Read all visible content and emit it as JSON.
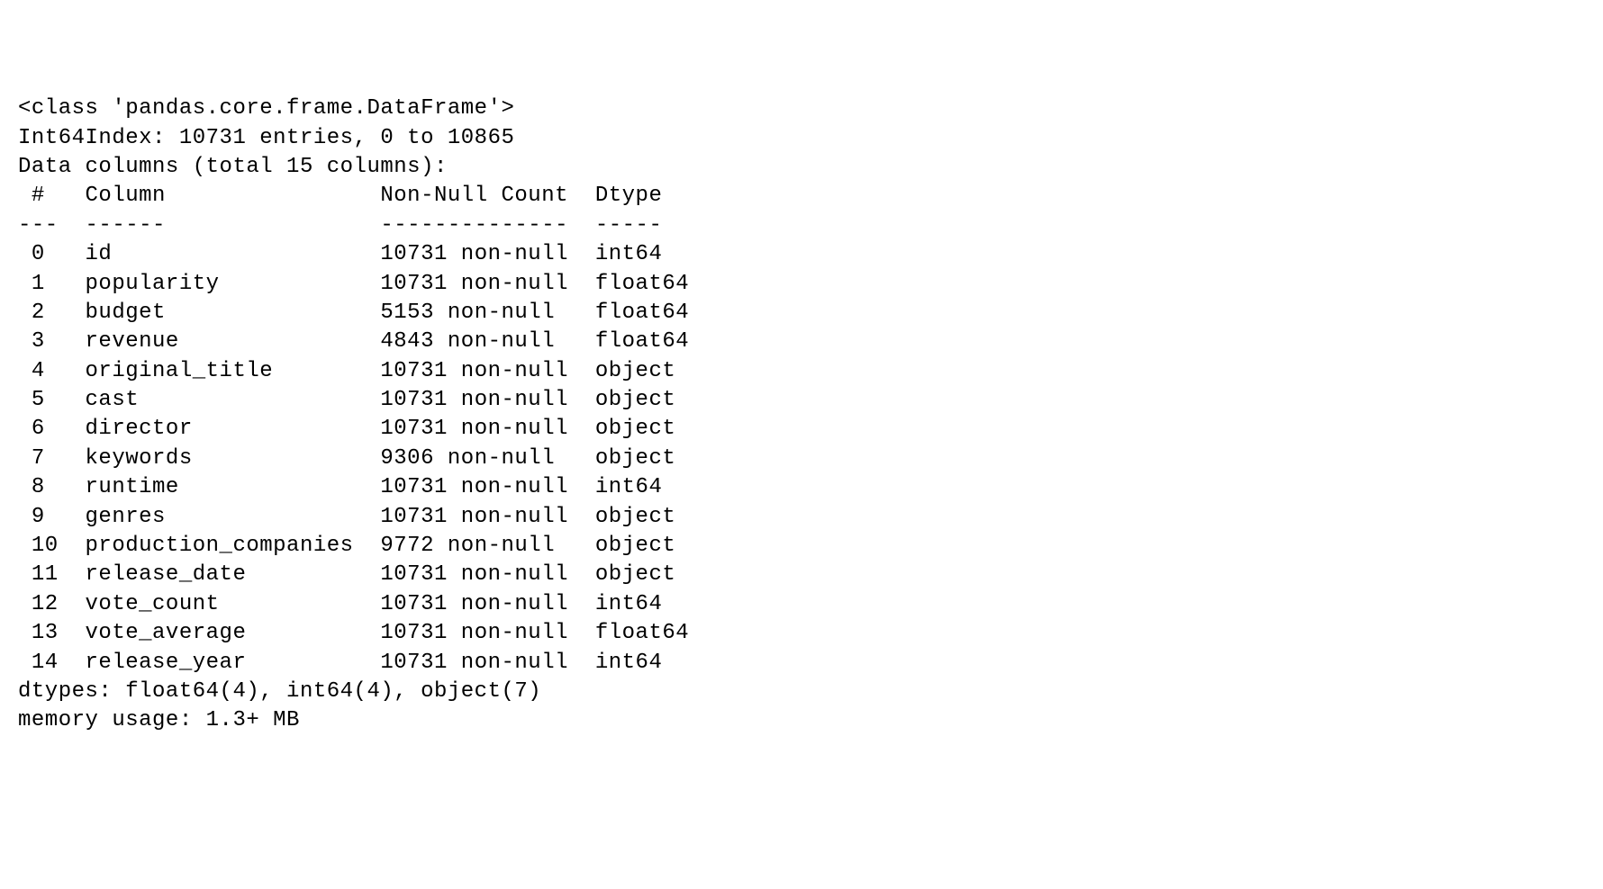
{
  "class_line": "<class 'pandas.core.frame.DataFrame'>",
  "index_line": "Int64Index: 10731 entries, 0 to 10865",
  "columns_line": "Data columns (total 15 columns):",
  "header": {
    "idx": " #  ",
    "column": "Column              ",
    "nonnull": "Non-Null Count",
    "dtype": "Dtype  "
  },
  "divider": {
    "idx": "--- ",
    "column": "------              ",
    "nonnull": "--------------",
    "dtype": "-----  "
  },
  "rows": [
    {
      "idx": " 0  ",
      "column": "id                  ",
      "nonnull": "10731 non-null",
      "dtype": "int64  "
    },
    {
      "idx": " 1  ",
      "column": "popularity          ",
      "nonnull": "10731 non-null",
      "dtype": "float64"
    },
    {
      "idx": " 2  ",
      "column": "budget              ",
      "nonnull": "5153 non-null ",
      "dtype": "float64"
    },
    {
      "idx": " 3  ",
      "column": "revenue             ",
      "nonnull": "4843 non-null ",
      "dtype": "float64"
    },
    {
      "idx": " 4  ",
      "column": "original_title      ",
      "nonnull": "10731 non-null",
      "dtype": "object "
    },
    {
      "idx": " 5  ",
      "column": "cast                ",
      "nonnull": "10731 non-null",
      "dtype": "object "
    },
    {
      "idx": " 6  ",
      "column": "director            ",
      "nonnull": "10731 non-null",
      "dtype": "object "
    },
    {
      "idx": " 7  ",
      "column": "keywords            ",
      "nonnull": "9306 non-null ",
      "dtype": "object "
    },
    {
      "idx": " 8  ",
      "column": "runtime             ",
      "nonnull": "10731 non-null",
      "dtype": "int64  "
    },
    {
      "idx": " 9  ",
      "column": "genres              ",
      "nonnull": "10731 non-null",
      "dtype": "object "
    },
    {
      "idx": " 10 ",
      "column": "production_companies",
      "nonnull": "9772 non-null ",
      "dtype": "object "
    },
    {
      "idx": " 11 ",
      "column": "release_date        ",
      "nonnull": "10731 non-null",
      "dtype": "object "
    },
    {
      "idx": " 12 ",
      "column": "vote_count          ",
      "nonnull": "10731 non-null",
      "dtype": "int64  "
    },
    {
      "idx": " 13 ",
      "column": "vote_average        ",
      "nonnull": "10731 non-null",
      "dtype": "float64"
    },
    {
      "idx": " 14 ",
      "column": "release_year        ",
      "nonnull": "10731 non-null",
      "dtype": "int64  "
    }
  ],
  "dtypes_line": "dtypes: float64(4), int64(4), object(7)",
  "memory_line": "memory usage: 1.3+ MB"
}
